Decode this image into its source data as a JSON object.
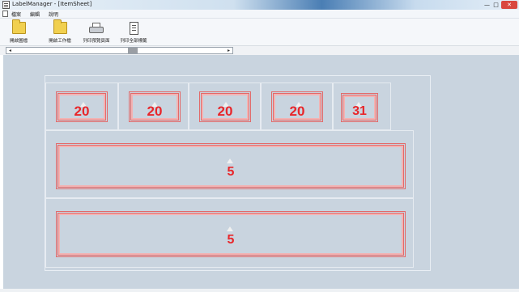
{
  "window": {
    "title": "LabelManager - [ItemSheet]",
    "min_label": "—",
    "max_label": "□",
    "close_label": "✕"
  },
  "menu": {
    "items": [
      "檔案",
      "編輯",
      "說明"
    ]
  },
  "toolbar": {
    "items": [
      {
        "label": "開啟圖檔",
        "icon": "folder-icon"
      },
      {
        "label": "開啟工作檔",
        "icon": "folder-icon"
      },
      {
        "label": "列印預覽頁面",
        "icon": "printer-icon"
      },
      {
        "label": "列印全部標籤",
        "icon": "document-print-icon"
      }
    ]
  },
  "scrollbar": {
    "left_arrow": "◂",
    "right_arrow": "▸"
  },
  "labels": {
    "row1": [
      "20",
      "20",
      "20",
      "20",
      "31"
    ],
    "row2": "5",
    "row3": "5"
  },
  "colors": {
    "workspace": "#c9d4df",
    "label_border": "#e26a6a",
    "label_text": "#e8262a"
  }
}
